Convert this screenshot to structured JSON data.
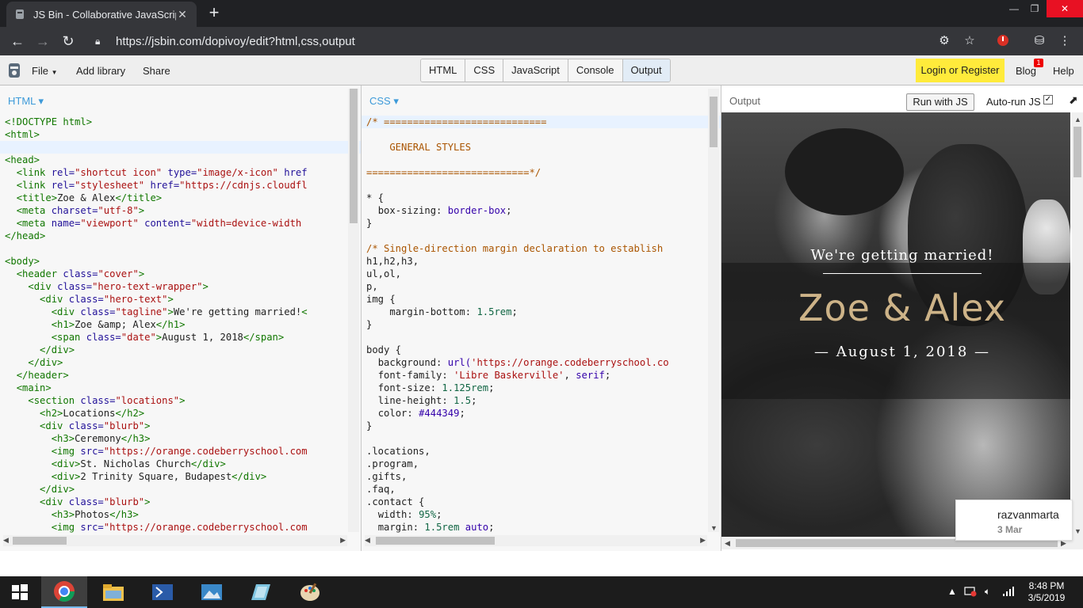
{
  "browser": {
    "tab_title": "JS Bin - Collaborative JavaScript Debugging",
    "tab_close": "✕",
    "new_tab": "+",
    "url": "https://jsbin.com/dopivoy/edit?html,css,output",
    "window_controls": {
      "minimize": "—",
      "restore": "❐",
      "close": "✕"
    }
  },
  "jsbin": {
    "menu": {
      "file": "File",
      "add_library": "Add library",
      "share": "Share"
    },
    "panels": [
      "HTML",
      "CSS",
      "JavaScript",
      "Console",
      "Output"
    ],
    "login": "Login or Register",
    "blog": "Blog",
    "blog_badge": "1",
    "help": "Help"
  },
  "html_pane": {
    "label": "HTML ▾"
  },
  "css_pane": {
    "label": "CSS ▾"
  },
  "output_pane": {
    "label": "Output",
    "run_button": "Run with JS",
    "autorun": "Auto-run JS",
    "checkbox": "✓",
    "popout": "⬈"
  },
  "output_page": {
    "tagline": "We're getting married!",
    "names": "Zoe & Alex",
    "date": "— August 1, 2018 —"
  },
  "user_card": {
    "name": "razvanmarta",
    "date": "3 Mar"
  },
  "clock": {
    "time": "8:48 PM",
    "date": "3/5/2019"
  }
}
